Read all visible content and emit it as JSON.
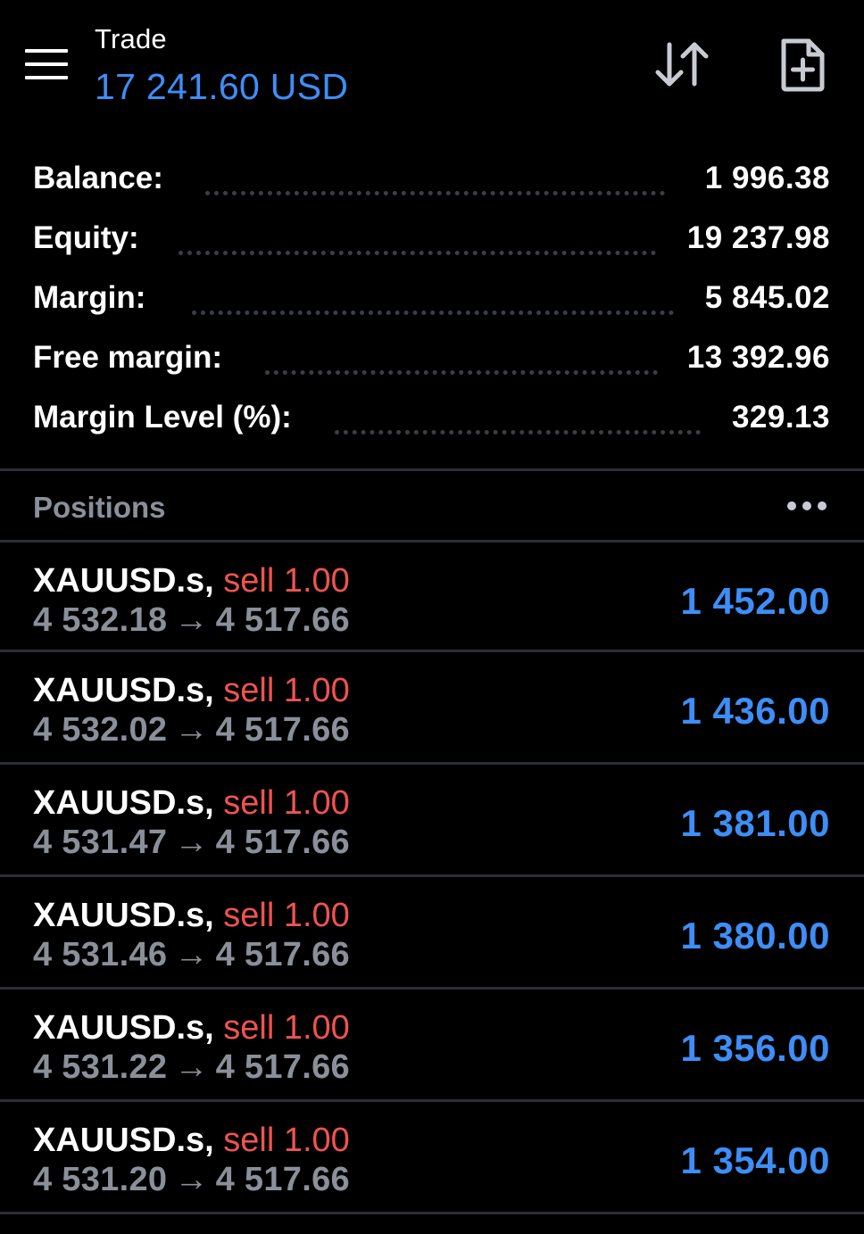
{
  "header": {
    "title": "Trade",
    "account_value": "17 241.60 USD",
    "icons": {
      "menu": "hamburger-menu-icon",
      "sort": "sort-arrows-icon",
      "new_order": "new-document-plus-icon"
    }
  },
  "summary": {
    "rows": [
      {
        "label": "Balance:",
        "value": "1 996.38"
      },
      {
        "label": "Equity:",
        "value": "19 237.98"
      },
      {
        "label": "Margin:",
        "value": "5 845.02"
      },
      {
        "label": "Free margin:",
        "value": "13 392.96"
      },
      {
        "label": "Margin Level (%):",
        "value": "329.13"
      }
    ]
  },
  "positions": {
    "title": "Positions",
    "items": [
      {
        "symbol": "XAUUSD.s,",
        "side": "sell 1.00",
        "open_price": "4 532.18",
        "arrow": "→",
        "current_price": "4 517.66",
        "profit": "1 452.00"
      },
      {
        "symbol": "XAUUSD.s,",
        "side": "sell 1.00",
        "open_price": "4 532.02",
        "arrow": "→",
        "current_price": "4 517.66",
        "profit": "1 436.00"
      },
      {
        "symbol": "XAUUSD.s,",
        "side": "sell 1.00",
        "open_price": "4 531.47",
        "arrow": "→",
        "current_price": "4 517.66",
        "profit": "1 381.00"
      },
      {
        "symbol": "XAUUSD.s,",
        "side": "sell 1.00",
        "open_price": "4 531.46",
        "arrow": "→",
        "current_price": "4 517.66",
        "profit": "1 380.00"
      },
      {
        "symbol": "XAUUSD.s,",
        "side": "sell 1.00",
        "open_price": "4 531.22",
        "arrow": "→",
        "current_price": "4 517.66",
        "profit": "1 356.00"
      },
      {
        "symbol": "XAUUSD.s,",
        "side": "sell 1.00",
        "open_price": "4 531.20",
        "arrow": "→",
        "current_price": "4 517.66",
        "profit": "1 354.00"
      }
    ]
  },
  "colors": {
    "background": "#000000",
    "accent_blue": "#3e8ef7",
    "sell_red": "#ef5350",
    "muted_gray": "#8a9099",
    "divider": "#2b2f35"
  }
}
